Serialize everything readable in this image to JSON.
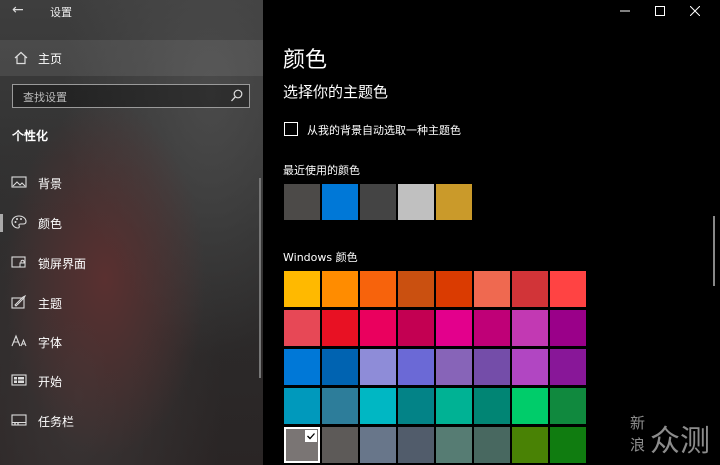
{
  "window": {
    "title": "设置",
    "back_glyph": "←",
    "minimize_glyph": "—",
    "maximize_glyph": "☐",
    "close_glyph": "✕"
  },
  "sidebar": {
    "home_label": "主页",
    "search_placeholder": "查找设置",
    "section_title": "个性化",
    "items": [
      {
        "label": "背景",
        "icon": "picture-icon"
      },
      {
        "label": "颜色",
        "icon": "palette-icon",
        "selected": true
      },
      {
        "label": "锁屏界面",
        "icon": "lock-screen-icon"
      },
      {
        "label": "主题",
        "icon": "theme-brush-icon"
      },
      {
        "label": "字体",
        "icon": "font-icon"
      },
      {
        "label": "开始",
        "icon": "start-menu-icon"
      },
      {
        "label": "任务栏",
        "icon": "taskbar-icon"
      }
    ]
  },
  "main": {
    "title": "颜色",
    "subtitle": "选择你的主题色",
    "auto_pick_label": "从我的背景自动选取一种主题色",
    "auto_pick_checked": false,
    "recent_label": "最近使用的颜色",
    "recent_colors": [
      "#4c4a48",
      "#0078d7",
      "#444444",
      "#c0c0c0",
      "#ca9a2a"
    ],
    "windows_colors_label": "Windows 颜色",
    "windows_colors": [
      [
        "#ffb900",
        "#ff8c00",
        "#f7630c",
        "#ca5010",
        "#da3b01",
        "#ef6950",
        "#d13438",
        "#ff4343"
      ],
      [
        "#e74856",
        "#e81123",
        "#ea005e",
        "#c30052",
        "#e3008c",
        "#bf0077",
        "#c239b3",
        "#9a0089"
      ],
      [
        "#0078d7",
        "#0063b1",
        "#8e8cd8",
        "#6b69d6",
        "#8764b8",
        "#744da9",
        "#b146c2",
        "#881798"
      ],
      [
        "#0099bc",
        "#2d7d9a",
        "#00b7c3",
        "#038387",
        "#00b294",
        "#018574",
        "#00cc6a",
        "#10893e"
      ],
      [
        "#7a7574",
        "#5d5a58",
        "#68768a",
        "#515c6b",
        "#567c73",
        "#486860",
        "#498205",
        "#107c10"
      ]
    ],
    "selected_color": "#7a7574"
  },
  "watermark": {
    "line1": "新",
    "line2": "浪",
    "big": "众测"
  }
}
